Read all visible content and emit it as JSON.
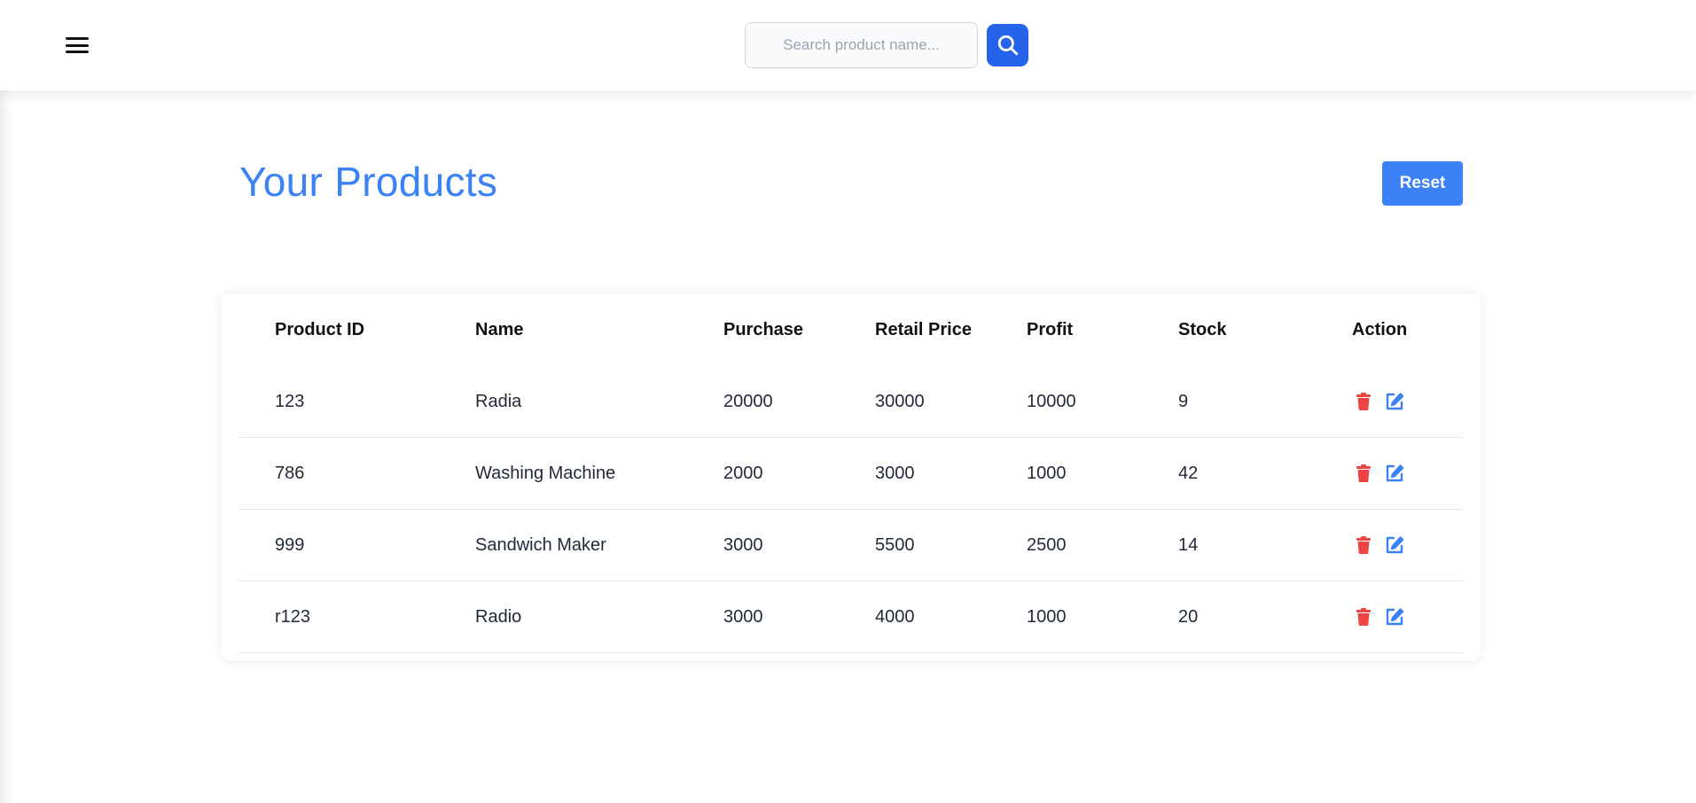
{
  "header": {
    "search": {
      "placeholder": "Search product name...",
      "value": ""
    },
    "accent_color": "#2563eb"
  },
  "main": {
    "title": "Your Products",
    "reset_label": "Reset",
    "title_color": "#3b82f6"
  },
  "table": {
    "columns": [
      "Product ID",
      "Name",
      "Purchase",
      "Retail Price",
      "Profit",
      "Stock",
      "Action"
    ],
    "rows": [
      {
        "id": "123",
        "name": "Radia",
        "purchase": "20000",
        "retail": "30000",
        "profit": "10000",
        "stock": "9"
      },
      {
        "id": "786",
        "name": "Washing Machine",
        "purchase": "2000",
        "retail": "3000",
        "profit": "1000",
        "stock": "42"
      },
      {
        "id": "999",
        "name": "Sandwich Maker",
        "purchase": "3000",
        "retail": "5500",
        "profit": "2500",
        "stock": "14"
      },
      {
        "id": "r123",
        "name": "Radio",
        "purchase": "3000",
        "retail": "4000",
        "profit": "1000",
        "stock": "20"
      }
    ],
    "action_icons": [
      "trash-icon",
      "edit-icon"
    ],
    "delete_color": "#ef4444",
    "edit_color": "#3b82f6"
  }
}
